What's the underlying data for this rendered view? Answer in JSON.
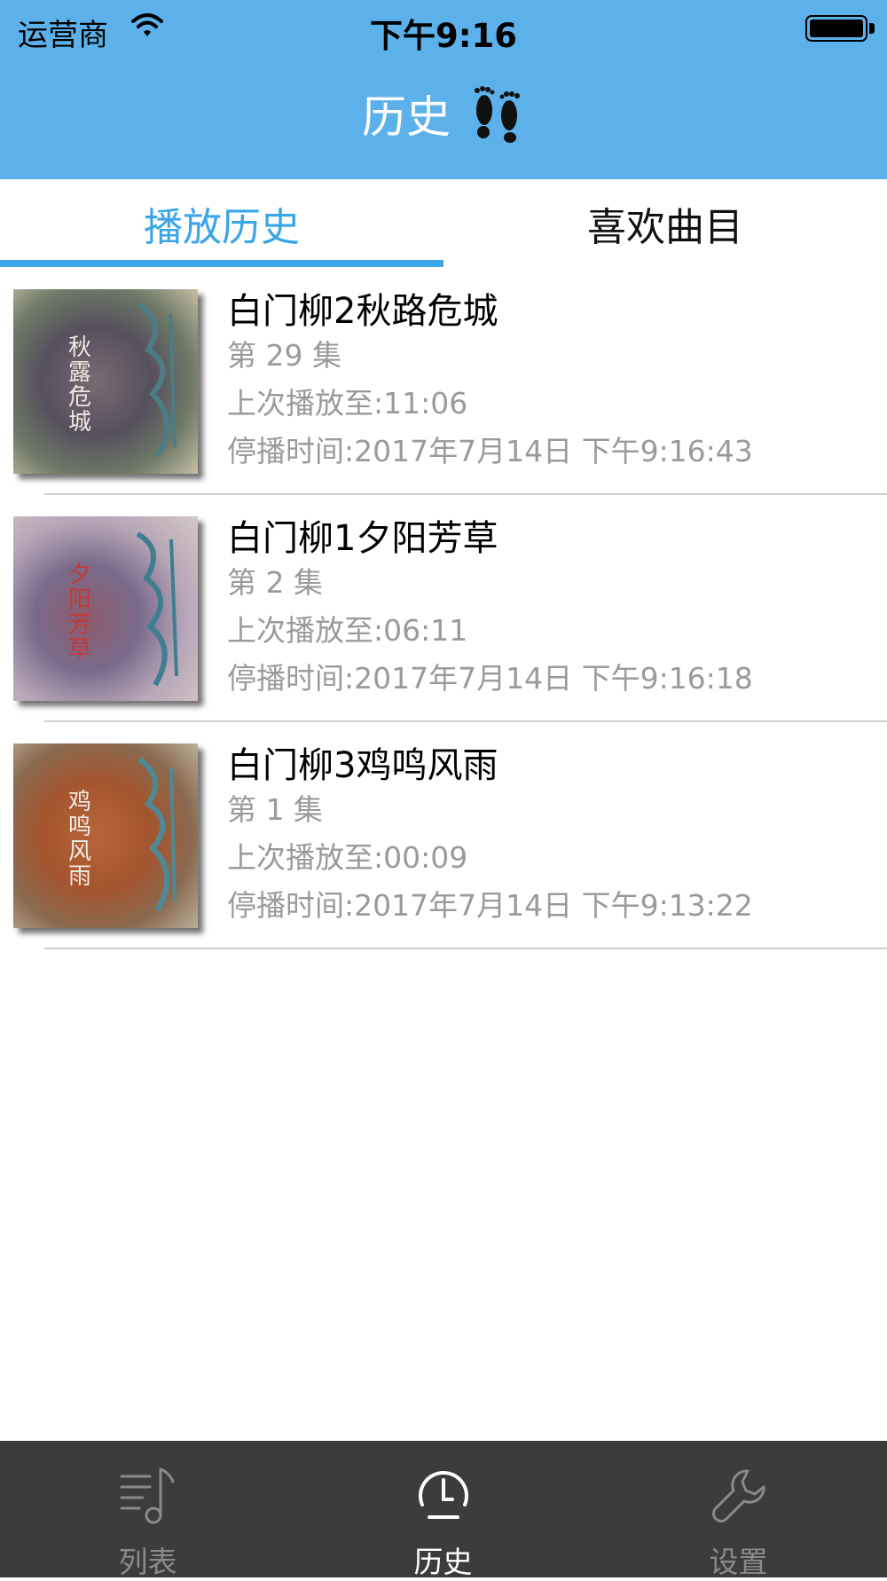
{
  "status_bar": {
    "carrier": "运营商",
    "time": "下午9:16"
  },
  "nav": {
    "title": "历史",
    "title_icon": "footprints-icon"
  },
  "tabs": [
    {
      "label": "播放历史",
      "active": true
    },
    {
      "label": "喜欢曲目",
      "active": false
    }
  ],
  "history": [
    {
      "cover_title": "秋露危城",
      "title": "白门柳2秋路危城",
      "episode": "第 29 集",
      "last_position": "上次播放至:11:06",
      "stopped_at": "停播时间:2017年7月14日 下午9:16:43"
    },
    {
      "cover_title": "夕阳芳草",
      "title": "白门柳1夕阳芳草",
      "episode": "第 2 集",
      "last_position": "上次播放至:06:11",
      "stopped_at": "停播时间:2017年7月14日 下午9:16:18"
    },
    {
      "cover_title": "鸡鸣风雨",
      "title": "白门柳3鸡鸣风雨",
      "episode": "第 1 集",
      "last_position": "上次播放至:00:09",
      "stopped_at": "停播时间:2017年7月14日 下午9:13:22"
    }
  ],
  "tabbar": [
    {
      "label": "列表",
      "icon": "music-list-icon",
      "selected": false
    },
    {
      "label": "历史",
      "icon": "clock-icon",
      "selected": true
    },
    {
      "label": "设置",
      "icon": "wrench-icon",
      "selected": false
    }
  ],
  "colors": {
    "nav_bg": "#5db1eb",
    "accent": "#3aa5e8",
    "tabbar_bg": "#3c3c3c"
  }
}
